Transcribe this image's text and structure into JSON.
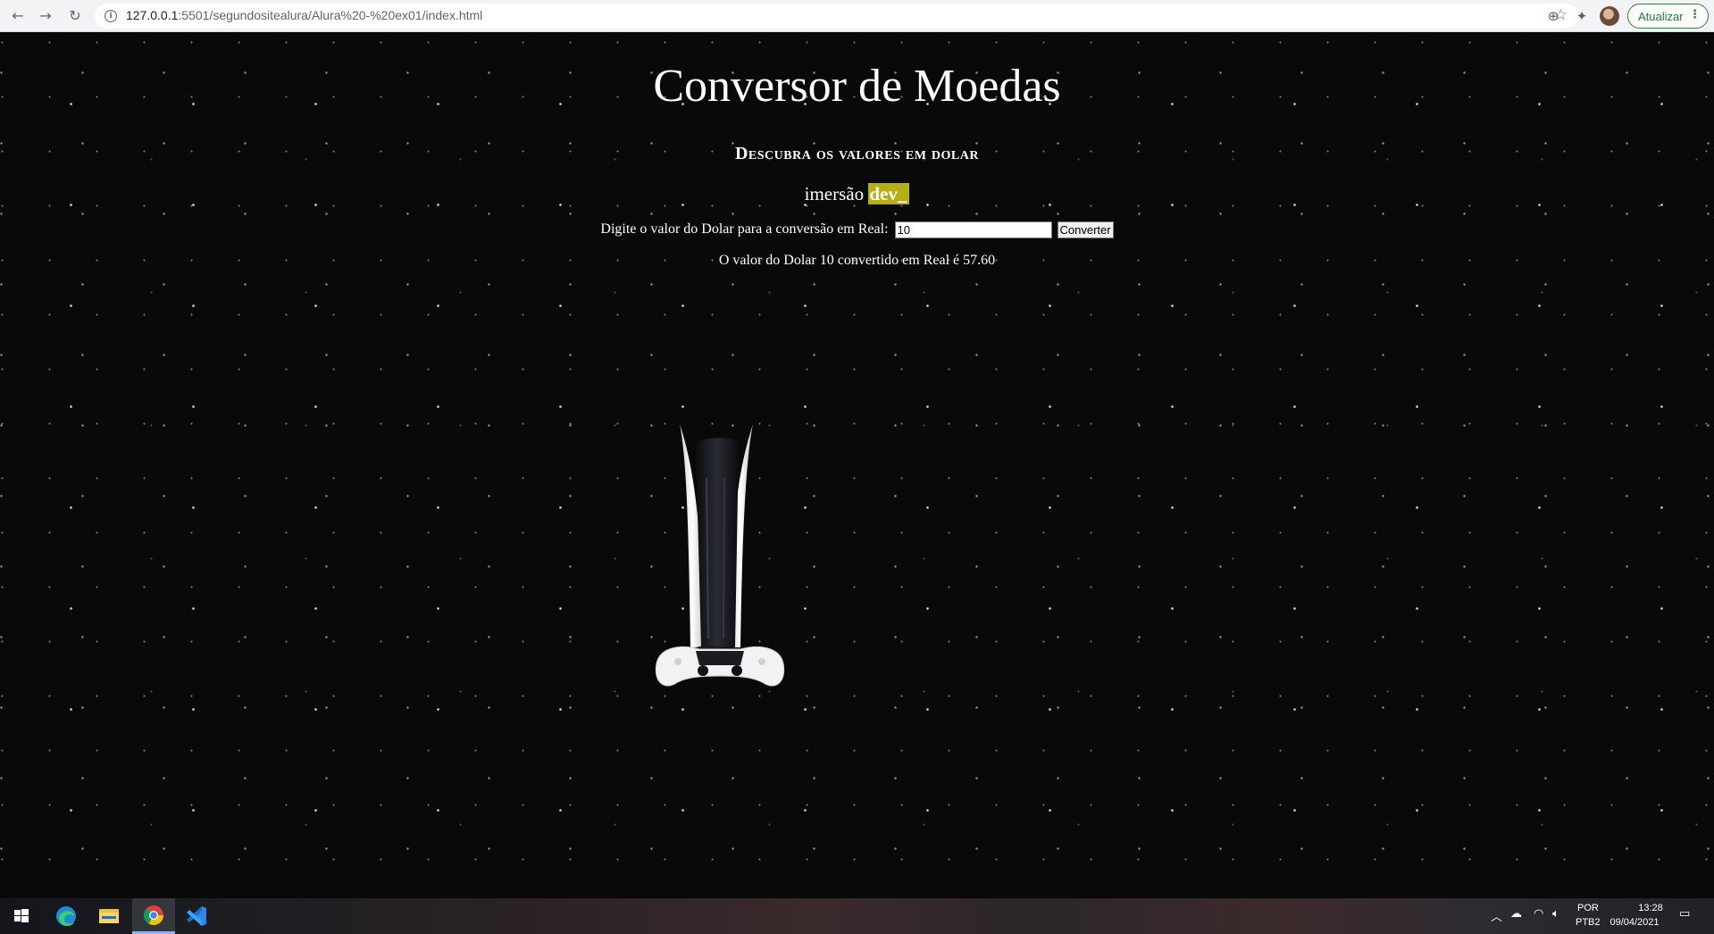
{
  "browser": {
    "url_host": "127.0.0.1",
    "url_rest": ":5501/segundositealura/Alura%20-%20ex01/index.html",
    "update_label": "Atualizar"
  },
  "page": {
    "title": "Conversor de Moedas",
    "subtitle": "Descubra os valores em dolar",
    "brand_text": "imersão",
    "brand_highlight": "dev_",
    "input_label": "Digite o valor do Dolar para a conversão em Real:",
    "input_value": "10",
    "convert_button": "Converter",
    "result": "O valor do Dolar 10 convertido em Real é 57.60",
    "image_icon": "ps5-console-image",
    "highlight_color": "#b5ae14"
  },
  "taskbar": {
    "language_top": "POR",
    "language_bottom": "PTB2",
    "time": "13:28",
    "date": "09/04/2021",
    "apps": [
      "windows-start-icon",
      "edge-icon",
      "file-explorer-icon",
      "chrome-icon",
      "vscode-icon"
    ]
  }
}
